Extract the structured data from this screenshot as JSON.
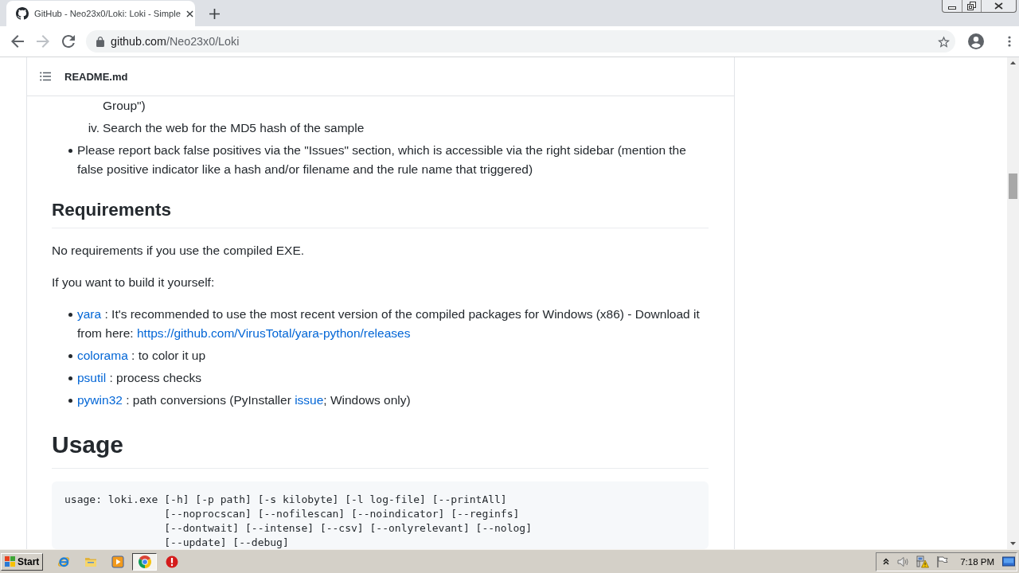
{
  "tabs": [
    {
      "title": "GitHub - Neo23x0/Loki: Loki - Simple",
      "selected": true
    }
  ],
  "toolbar": {
    "nav": [
      {
        "kind": "back",
        "disabled": false
      },
      {
        "kind": "forward",
        "disabled": true
      },
      {
        "kind": "reload",
        "disabled": false
      }
    ],
    "address": {
      "host": "github.com",
      "path": "/Neo23x0/Loki"
    },
    "bookmarked": false
  },
  "readme": {
    "title": "README.md",
    "blocks": [
      {
        "kind": "bullet_list",
        "items": [
          {
            "children": [
              {
                "text": "Group\")"
              },
              {
                "marker": "iv.",
                "text": "Search the web for the MD5 hash of the sample"
              }
            ]
          },
          {
            "text": "Please report back false positives via the \"Issues\" section, which is accessible via the right sidebar (mention the false positive indicator like a hash and/or filename and the rule name that triggered)"
          }
        ]
      },
      {
        "kind": "h2",
        "text": "Requirements"
      },
      {
        "kind": "paragraph",
        "text": "No requirements if you use the compiled EXE."
      },
      {
        "kind": "paragraph",
        "text": "If you want to build it yourself:"
      },
      {
        "kind": "bullet_list",
        "items": [
          {
            "parts": [
              {
                "kind": "link",
                "text": "yara"
              },
              {
                "kind": "text",
                "text": " : It's recommended to use the most recent version of the compiled packages for Windows (x86) - Download it from here: "
              },
              {
                "kind": "link",
                "text": "https://github.com/VirusTotal/yara-python/releases"
              }
            ]
          },
          {
            "parts": [
              {
                "kind": "link",
                "text": "colorama"
              },
              {
                "kind": "text",
                "text": " : to color it up"
              }
            ]
          },
          {
            "parts": [
              {
                "kind": "link",
                "text": "psutil"
              },
              {
                "kind": "text",
                "text": " : process checks"
              }
            ]
          },
          {
            "parts": [
              {
                "kind": "link",
                "text": "pywin32"
              },
              {
                "kind": "text",
                "text": " : path conversions (PyInstaller "
              },
              {
                "kind": "link",
                "text": "issue"
              },
              {
                "kind": "text",
                "text": "; Windows only)"
              }
            ]
          }
        ]
      },
      {
        "kind": "h1",
        "text": "Usage"
      },
      {
        "kind": "code",
        "text": "usage: loki.exe [-h] [-p path] [-s kilobyte] [-l log-file] [--printAll]\n                [--noprocscan] [--nofilescan] [--noindicator] [--reginfs]\n                [--dontwait] [--intense] [--csv] [--onlyrelevant] [--nolog]\n                [--update] [--debug]"
      }
    ]
  },
  "taskbar": {
    "start": "Start",
    "apps": [
      {
        "kind": "browser_e",
        "selected": false
      },
      {
        "kind": "folder",
        "selected": false
      },
      {
        "kind": "player",
        "selected": false
      },
      {
        "kind": "browser_circle",
        "selected": true
      },
      {
        "kind": "alert",
        "selected": false
      }
    ],
    "clock": "7:18 PM"
  }
}
